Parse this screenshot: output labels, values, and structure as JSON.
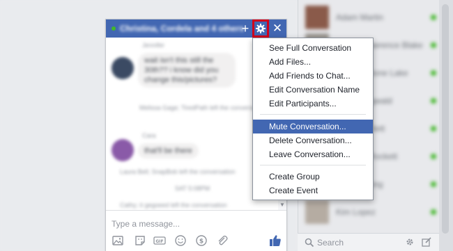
{
  "colors": {
    "facebook_blue": "#4267b2",
    "highlight_red": "#d0021b",
    "online_green": "#42b72a"
  },
  "chat_window": {
    "title": "Christina, Cordela and 4 others",
    "icons": [
      "add-people-icon",
      "gear-icon",
      "close-icon"
    ],
    "messages": [
      {
        "sender": "Jennifer",
        "text": "wait isn't this still the 30th?? i know did you change this/pictures?"
      },
      {
        "system": "Melissa Gage; TiredPath left the conversation"
      },
      {
        "sender": "Cara",
        "text": "that'll be there"
      },
      {
        "system": "Laura Bell; SnapBob left the conversation"
      },
      {
        "time": "SAT 5:08PM"
      },
      {
        "system": "Cathy; it gegoeed left the conversation"
      }
    ],
    "composer": {
      "placeholder": "Type a message..."
    },
    "composer_tools": [
      "photo-icon",
      "sticker-icon",
      "gif-icon",
      "emoji-icon",
      "payment-icon",
      "attachment-icon",
      "thumbs-up-icon"
    ]
  },
  "menu": {
    "groups": [
      [
        "See Full Conversation",
        "Add Files...",
        "Add Friends to Chat...",
        "Edit Conversation Name",
        "Edit Participants..."
      ],
      [
        "Mute Conversation...",
        "Delete Conversation...",
        "Leave Conversation..."
      ],
      [
        "Create Group",
        "Create Event"
      ]
    ],
    "highlighted": "Mute Conversation..."
  },
  "sidebar": {
    "contacts": [
      "Adam Martin",
      "Ashley Lawrence Blake",
      "Liz Johnstone Lake",
      "Chris Ringwald",
      "Dana Bartlett",
      "Jackson Rockett",
      "Marta Young",
      "Kim Lopez"
    ],
    "search_placeholder": "Search",
    "footer_icons": [
      "search-icon",
      "gear-icon",
      "compose-icon"
    ]
  }
}
